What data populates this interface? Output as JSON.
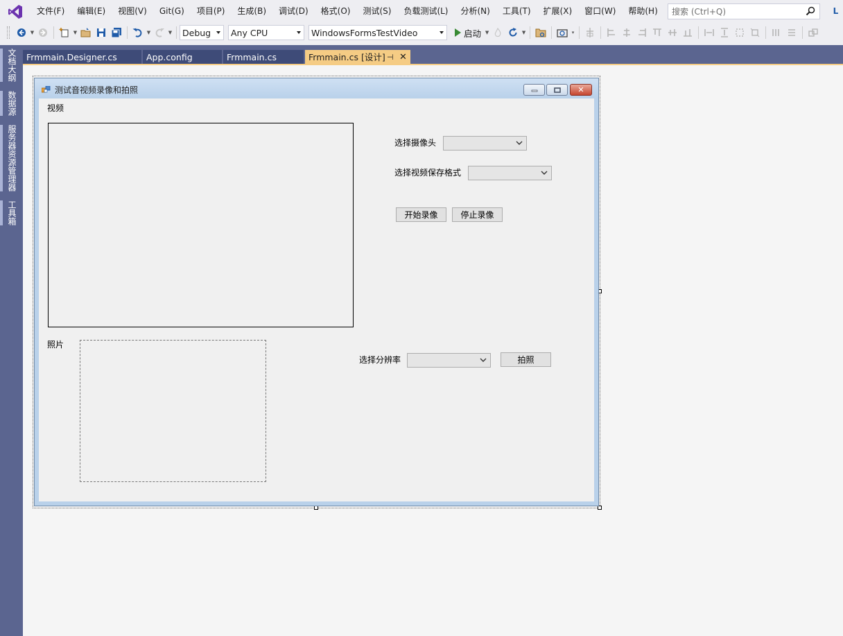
{
  "menu": {
    "items": [
      "文件(F)",
      "编辑(E)",
      "视图(V)",
      "Git(G)",
      "项目(P)",
      "生成(B)",
      "调试(D)",
      "格式(O)",
      "测试(S)",
      "负载测试(L)",
      "分析(N)",
      "工具(T)",
      "扩展(X)",
      "窗口(W)",
      "帮助(H)"
    ],
    "search_placeholder": "搜索 (Ctrl+Q)",
    "corner_badge": "L"
  },
  "toolbar": {
    "configuration": "Debug",
    "platform": "Any CPU",
    "startup_project": "WindowsFormsTestVideo",
    "start_label": "启动"
  },
  "sidebar": {
    "tabs": [
      "文档大纲",
      "数据源",
      "服务器资源管理器",
      "工具箱"
    ]
  },
  "doc_tabs": {
    "tabs": [
      "Frmmain.Designer.cs",
      "App.config",
      "Frmmain.cs",
      "Frmmain.cs [设计]"
    ],
    "active_index": 3
  },
  "form": {
    "title": "测试音视频录像和拍照",
    "video_label": "视频",
    "camera_label": "选择摄像头",
    "format_label": "选择视频保存格式",
    "start_record_button": "开始录像",
    "stop_record_button": "停止录像",
    "photo_label": "照片",
    "resolution_label": "选择分辨率",
    "capture_button": "拍照"
  }
}
